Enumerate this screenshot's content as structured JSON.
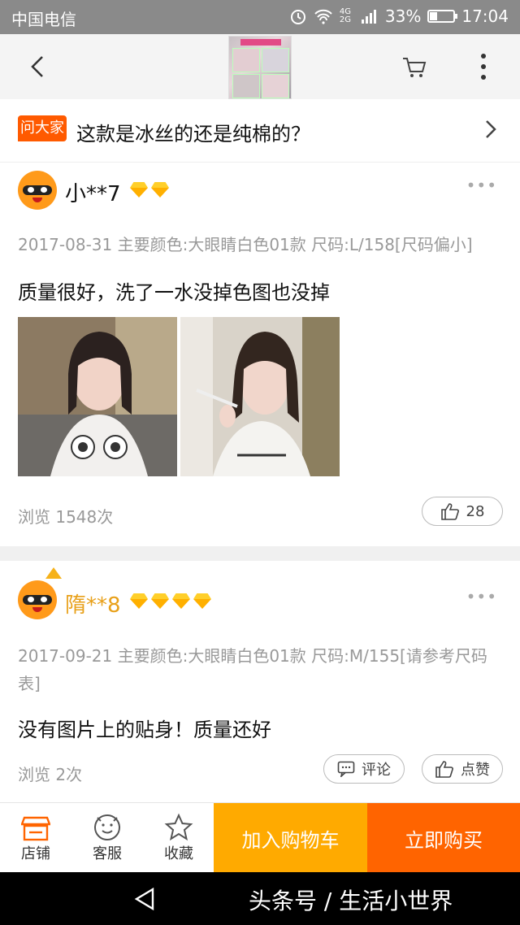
{
  "status_bar": {
    "carrier": "中国电信",
    "network": "4G 2G",
    "battery": "33%",
    "battery_level": 0.33,
    "time": "17:04"
  },
  "nav": {
    "back_icon": "chevron-left-icon",
    "cart_icon": "cart-icon",
    "more_icon": "more-vertical-icon"
  },
  "question": {
    "badge": "问大家",
    "text": "这款是冰丝的还是纯棉的？"
  },
  "reviews": [
    {
      "username": "小**7",
      "diamonds": 2,
      "meta": "2017-08-31 主要颜色:大眼睛白色01款 尺码:L/158[尺码偏小]",
      "content": "质量很好，洗了一水没掉色图也没掉",
      "views": "浏览 1548次",
      "like_count": "28",
      "photos": 2
    },
    {
      "username": "隋**8",
      "diamonds": 4,
      "meta": "2017-09-21 主要颜色:大眼睛白色01款 尺码:M/155[请参考尺码表]",
      "content": "没有图片上的贴身！质量还好",
      "views": "浏览 2次",
      "comment_label": "评论",
      "like_label": "点赞"
    }
  ],
  "bottom_bar": {
    "shop": "店铺",
    "service": "客服",
    "favorite": "收藏",
    "add_to_cart": "加入购物车",
    "buy_now": "立即购买"
  },
  "watermark": "头条号 / 生活小世界",
  "colors": {
    "accent": "#ff6400",
    "cart": "#ffaa00",
    "badge": "#ff5a00",
    "status_bar": "#8a8a8a"
  }
}
